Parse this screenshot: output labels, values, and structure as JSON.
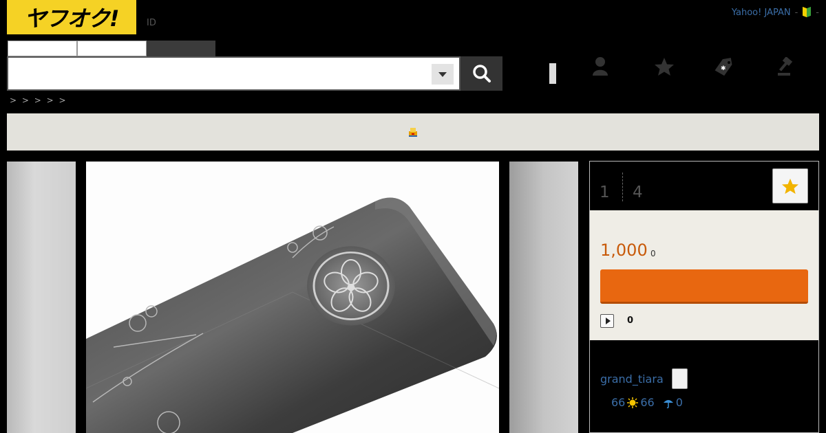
{
  "header": {
    "logo_text": "ヤフオク!",
    "id_link": "ID",
    "right_link": "Yahoo! JAPAN",
    "sep1": "-",
    "sep2": "-"
  },
  "search": {
    "value": "",
    "placeholder": ""
  },
  "breadcrumb": ">   > > > >",
  "gallery": {
    "current_page": "1",
    "total_pages": "4"
  },
  "price": {
    "amount": "1,000",
    "unit": "0",
    "bid_count": "0"
  },
  "seller": {
    "name": "grand_tiara",
    "rating_total": "66",
    "rating_good": "66",
    "rating_bad": "0"
  },
  "colors": {
    "brand_yellow": "#f5d225",
    "bid_orange": "#e86710",
    "link_blue": "#3b6ea8",
    "price_orange": "#c85a0a"
  },
  "icons": [
    "search-icon",
    "chevron-down-icon",
    "user-icon",
    "star-icon",
    "tag-icon",
    "gavel-icon",
    "beginner-mark-icon",
    "sun-icon",
    "umbrella-icon",
    "play-icon"
  ]
}
